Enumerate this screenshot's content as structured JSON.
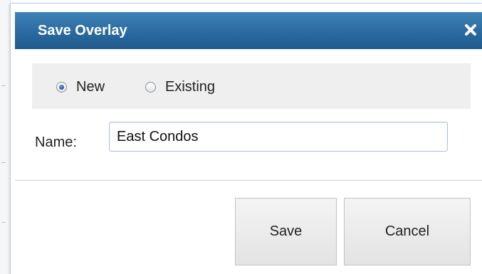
{
  "dialog": {
    "title": "Save Overlay",
    "close_icon": "close-icon"
  },
  "overlay_type": {
    "options": [
      {
        "label": "New",
        "checked": true
      },
      {
        "label": "Existing",
        "checked": false
      }
    ]
  },
  "name_field": {
    "label": "Name:",
    "value": "East Condos"
  },
  "buttons": {
    "save_label": "Save",
    "cancel_label": "Cancel"
  },
  "colors": {
    "titlebar": "#2a6aa0",
    "radio_panel": "#efefef",
    "button": "#e8e8e8"
  }
}
